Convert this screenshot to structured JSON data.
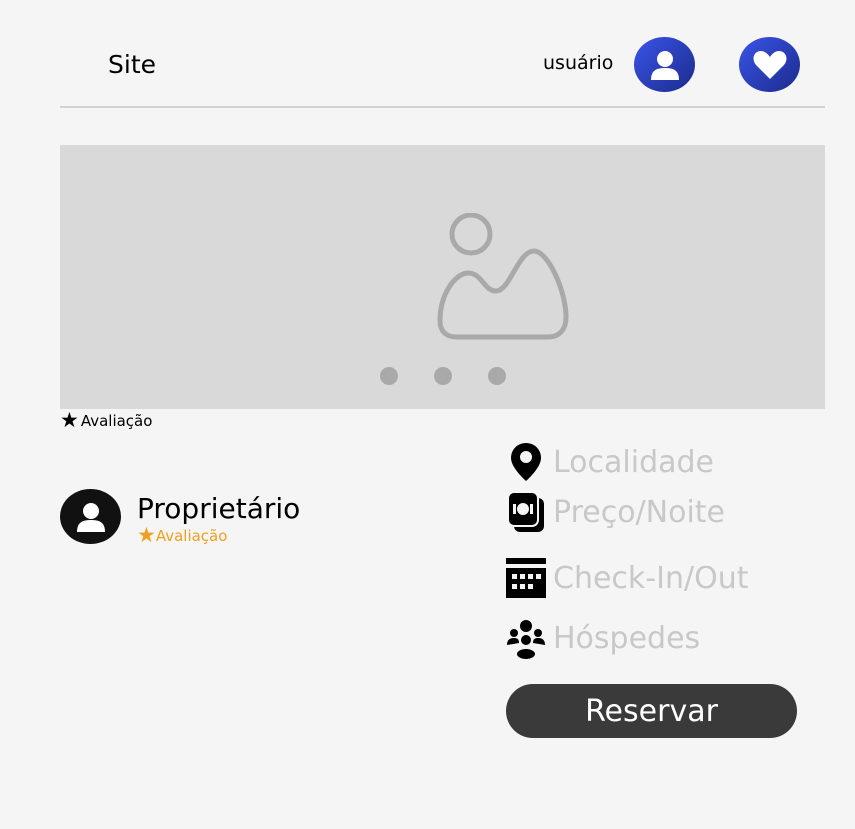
{
  "header": {
    "title": "Site",
    "user_label": "usuário"
  },
  "gallery": {
    "dots": 3
  },
  "listing": {
    "rating_label": "Avaliação"
  },
  "owner": {
    "name": "Proprietário",
    "rating_label": "Avaliação"
  },
  "details": {
    "location": "Localidade",
    "price": "Preço/Noite",
    "checkin": "Check-In/Out",
    "guests": "Hóspedes"
  },
  "actions": {
    "reserve_label": "Reservar"
  },
  "colors": {
    "accent": "#2f44c4",
    "star_owner": "#f0a020",
    "button": "#3a3a3a",
    "muted_text": "#c8c8c8"
  }
}
